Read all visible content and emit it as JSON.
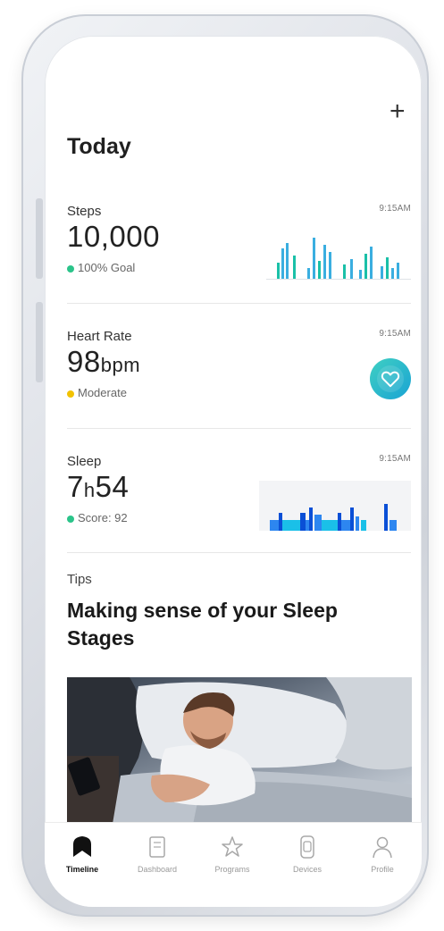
{
  "header": {
    "add_icon": "plus-icon",
    "add_label": "+",
    "title": "Today"
  },
  "cards": {
    "steps": {
      "title": "Steps",
      "time": "9:15AM",
      "value": "10,000",
      "status": "100% Goal",
      "status_color": "#2bc48a",
      "chart_color": "#3aaee0"
    },
    "heart": {
      "title": "Heart Rate",
      "time": "9:15AM",
      "value": "98",
      "unit": "bpm",
      "status": "Moderate",
      "status_color": "#f2c200",
      "badge_icon": "heart-icon",
      "badge_color": "#24b6cc"
    },
    "sleep": {
      "title": "Sleep",
      "time": "9:15AM",
      "value_hours": "7",
      "value_h": "h",
      "value_minutes": "54",
      "status": "Score: 92",
      "status_color": "#2bc48a",
      "chart_colors": [
        "#0a4fd6",
        "#2d86f0",
        "#1ac0e8"
      ]
    }
  },
  "tips": {
    "label": "Tips",
    "title": "Making sense of your Sleep Stages"
  },
  "tabs": [
    {
      "label": "Timeline",
      "icon": "timeline-icon",
      "active": true
    },
    {
      "label": "Dashboard",
      "icon": "dashboard-icon",
      "active": false
    },
    {
      "label": "Programs",
      "icon": "star-icon",
      "active": false
    },
    {
      "label": "Devices",
      "icon": "device-icon",
      "active": false
    },
    {
      "label": "Profile",
      "icon": "profile-icon",
      "active": false
    }
  ]
}
